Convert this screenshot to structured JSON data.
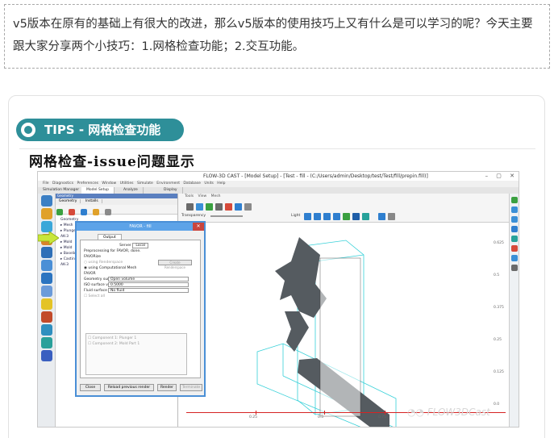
{
  "intro": {
    "text": "v5版本在原有的基础上有很大的改进，那么v5版本的使用技巧上又有什么是可以学习的呢？今天主要跟大家分享两个小技巧：1.网格检查功能；2.交互功能。"
  },
  "tips": {
    "badge": "TIPS - 网格检查功能",
    "section_title": "网格检查-issue问题显示"
  },
  "app": {
    "window_title": "FLOW-3D CAST - [Model Setup] - [Test - fill - (C:/Users/admin/Desktop/test/Test/fill/prepin.fill)]",
    "window_controls": "– ▢ ✕",
    "menu": "File  Diagnostics  Preferences  Window  Utilities  Simulate  Environment  Database  Units  Help",
    "tabs": [
      "Simulation Manager",
      "Model Setup",
      "Analyze",
      "Display"
    ],
    "geometry_panel": {
      "header": "Geometry",
      "tabs": [
        "Geometry",
        "Installs"
      ],
      "tree": [
        "Geometry",
        "▸ Mesh",
        "  ▸ Plunger",
        "  AK-3",
        "▸ Mold",
        "  ▸ Mold",
        "  ▸ Baseline",
        "▸ Casting",
        "  AK-3"
      ]
    },
    "view": {
      "toolbar_label": "Tools  View  Mesh",
      "transparency_label": "Transparency",
      "light_label": "Light",
      "axis_ticks": [
        "0.25",
        "0.5",
        "0.75"
      ],
      "axis_right": [
        "0.625",
        "0.5",
        "0.375",
        "0.25",
        "0.125",
        "0.0"
      ]
    },
    "dialog": {
      "title": "FAVOR - fill",
      "close": "✕",
      "tab": "Output",
      "solver_label": "Server",
      "solver_value": "Local",
      "preprocessing": "Preprocessing for FAVOR, done.",
      "favorize": "FAVORize",
      "opt_renderspace": "using Renderspace",
      "opt_mesh": "using Computational Mesh",
      "create_button": "Create Renderspace",
      "favor_label": "FAVOR",
      "geometry_surface_label": "Geometry surface",
      "geometry_surface_value": "Open volume",
      "iso_label": "ISO surface value",
      "iso_value": "0.5000",
      "fluid_surface_label": "Fluid surface",
      "fluid_surface_value": "No fluid",
      "select_all": "Select all",
      "components": [
        "Component 1: Plunger 1",
        "Component 2: Mold Part 1"
      ],
      "btn_close": "Close",
      "btn_reload": "Reload previous render",
      "btn_render": "Render",
      "btn_terminate": "Terminate"
    },
    "watermark": "FLOW3DCast"
  },
  "colors": {
    "badge_bg": "#2e8f99",
    "dialog_border": "#4a8fd6",
    "mesh_box": "#36d0d8",
    "part": "#555b60",
    "axis": "#d62424"
  }
}
